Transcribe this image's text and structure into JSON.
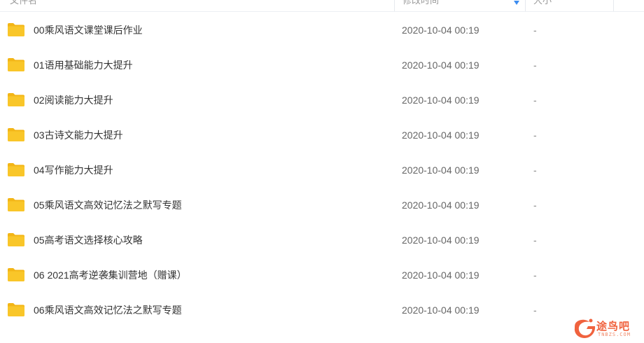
{
  "header": {
    "name_label": "文件名",
    "date_label": "修改时间",
    "size_label": "大小"
  },
  "files": [
    {
      "name": "00乘风语文课堂课后作业",
      "date": "2020-10-04 00:19",
      "size": "-",
      "icon": "folder-icon"
    },
    {
      "name": "01语用基础能力大提升",
      "date": "2020-10-04 00:19",
      "size": "-",
      "icon": "folder-icon"
    },
    {
      "name": "02阅读能力大提升",
      "date": "2020-10-04 00:19",
      "size": "-",
      "icon": "folder-icon"
    },
    {
      "name": "03古诗文能力大提升",
      "date": "2020-10-04 00:19",
      "size": "-",
      "icon": "folder-icon"
    },
    {
      "name": "04写作能力大提升",
      "date": "2020-10-04 00:19",
      "size": "-",
      "icon": "folder-icon"
    },
    {
      "name": "05乘风语文高效记忆法之默写专题",
      "date": "2020-10-04 00:19",
      "size": "-",
      "icon": "folder-icon"
    },
    {
      "name": "05高考语文选择核心攻略",
      "date": "2020-10-04 00:19",
      "size": "-",
      "icon": "folder-icon"
    },
    {
      "name": "06 2021高考逆袭集训营地（赠课）",
      "date": "2020-10-04 00:19",
      "size": "-",
      "icon": "folder-icon"
    },
    {
      "name": "06乘风语文高效记忆法之默写专题",
      "date": "2020-10-04 00:19",
      "size": "-",
      "icon": "folder-icon"
    }
  ],
  "watermark": {
    "text": "途鸟吧",
    "sub": "TNBZS.COM"
  },
  "colors": {
    "folder": "#f9c629",
    "folder_tab": "#f3b516",
    "sort_arrow": "#3b8cf0",
    "watermark": "#f0623e"
  }
}
